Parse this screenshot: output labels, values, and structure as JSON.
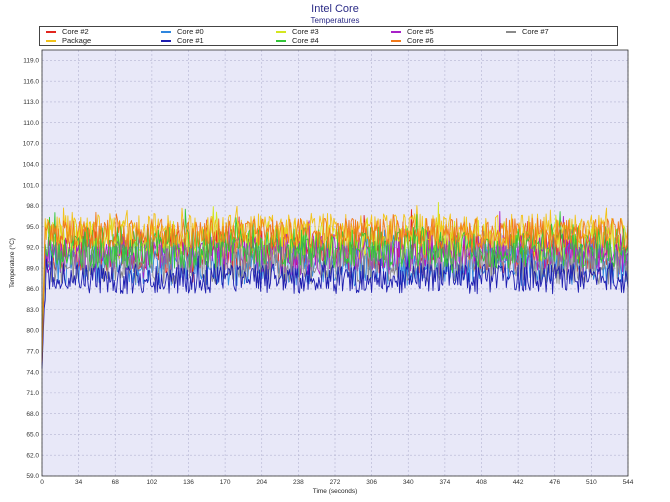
{
  "chart_data": {
    "type": "line",
    "title": "Intel Core",
    "subtitle": "Temperatures",
    "xlabel": "Time (seconds)",
    "ylabel": "Temperature (°C)",
    "xlim": [
      0,
      544
    ],
    "ylim": [
      59.0,
      120.5
    ],
    "x_ticks": [
      0,
      34,
      68,
      102,
      136,
      170,
      204,
      238,
      272,
      306,
      340,
      374,
      408,
      442,
      476,
      510,
      544
    ],
    "y_ticks": [
      59.0,
      62.0,
      65.0,
      68.0,
      71.0,
      74.0,
      77.0,
      80.0,
      83.0,
      86.0,
      89.0,
      92.0,
      95.0,
      98.0,
      101.0,
      104.0,
      107.0,
      110.0,
      113.0,
      116.0,
      119.0
    ],
    "grid": true,
    "legend_position": "top",
    "plot_background": "#e8e8f8",
    "grid_color": "#b4b4d2",
    "series": [
      {
        "name": "Core #2",
        "color": "#e2261f",
        "start": 75.0,
        "mean": 91.5,
        "spread": 3.2,
        "seed": 11
      },
      {
        "name": "Core #0",
        "color": "#2f86de",
        "start": 79.0,
        "mean": 89.5,
        "spread": 3.0,
        "seed": 23
      },
      {
        "name": "Core #3",
        "color": "#d4e620",
        "start": 78.0,
        "mean": 93.0,
        "spread": 2.8,
        "seed": 37
      },
      {
        "name": "Core #5",
        "color": "#a820c8",
        "start": 76.0,
        "mean": 91.0,
        "spread": 3.0,
        "seed": 41
      },
      {
        "name": "Core #7",
        "color": "#8a8a8a",
        "start": 77.0,
        "mean": 89.5,
        "spread": 2.8,
        "seed": 53
      },
      {
        "name": "Package",
        "color": "#f2c31a",
        "start": 80.0,
        "mean": 94.5,
        "spread": 2.4,
        "seed": 67
      },
      {
        "name": "Core #1",
        "color": "#1e1eb0",
        "start": 74.5,
        "mean": 87.5,
        "spread": 2.2,
        "seed": 71
      },
      {
        "name": "Core #4",
        "color": "#34c63a",
        "start": 76.5,
        "mean": 92.0,
        "spread": 3.0,
        "seed": 83
      },
      {
        "name": "Core #6",
        "color": "#f27a1a",
        "start": 75.5,
        "mean": 94.0,
        "spread": 2.2,
        "seed": 97
      }
    ]
  }
}
